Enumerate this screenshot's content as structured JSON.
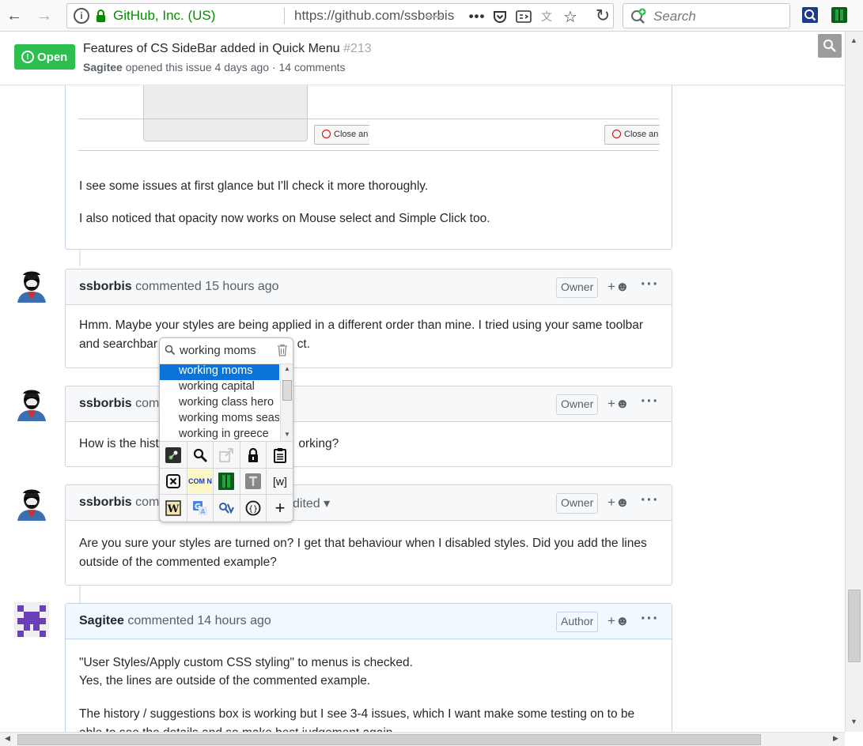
{
  "browser": {
    "org_name": "GitHub, Inc. (US)",
    "url": "https://github.com/ssborbis",
    "search_placeholder": "Search"
  },
  "issue": {
    "status": "Open",
    "title": "Features of CS SideBar added in Quick Menu",
    "number": "#213",
    "author": "Sagitee",
    "meta_rest": " opened this issue 4 days ago · 14 comments"
  },
  "first_comment": {
    "close_btn_1": "Close an",
    "close_btn_2": "Close an",
    "para_1": "I see some issues at first glance but I'll check it more thoroughly.",
    "para_2": "I also noticed that opacity now works on Mouse select and Simple Click too."
  },
  "comments": [
    {
      "author": "ssborbis",
      "action": " commented 15 hours ago",
      "role": "Owner",
      "line_1": "Hmm. Maybe your styles are being applied in a different order than mine. I tried using your same toolbar",
      "line_2": "and searchbar                                         ct."
    },
    {
      "author": "ssborbis",
      "action": " comm",
      "role": "Owner",
      "line_1": "How is the hist                                         orking?"
    },
    {
      "author": "ssborbis",
      "action": " comm",
      "edited": "dited ▾",
      "role": "Owner",
      "line_1": "Are you sure your styles are turned on? I get that behaviour when I disabled styles. Did you add the lines",
      "line_2": "outside of the commented example?"
    },
    {
      "author": "Sagitee",
      "action": " commented 14 hours ago",
      "role": "Author",
      "line_1": "\"User Styles/Apply custom CSS styling\" to menus is checked.",
      "line_2": "Yes, the lines are outside of the commented example.",
      "line_3": "The history / suggestions box is working but I see 3-4 issues, which I want make some testing on to be",
      "line_4": "able to see the details and so make best judgement again"
    }
  ],
  "popup": {
    "query": "working moms",
    "suggestions": [
      "working moms",
      "working capital",
      "working class hero",
      "working moms seas",
      "working in greece"
    ],
    "tiles": [
      "options-icon",
      "search-mag-icon",
      "new-window-icon",
      "lock-icon",
      "clipboard-icon",
      "close-x-icon",
      "com-domain-icon",
      "green-book-icon",
      "text-t-icon",
      "wiki-bracket-icon",
      "wikipedia-icon",
      "google-translate-icon",
      "search-engine-icon",
      "code-braces-icon",
      "add-plus-icon"
    ],
    "tile_text": {
      "com": "COM N",
      "wiki": "[w]"
    }
  }
}
